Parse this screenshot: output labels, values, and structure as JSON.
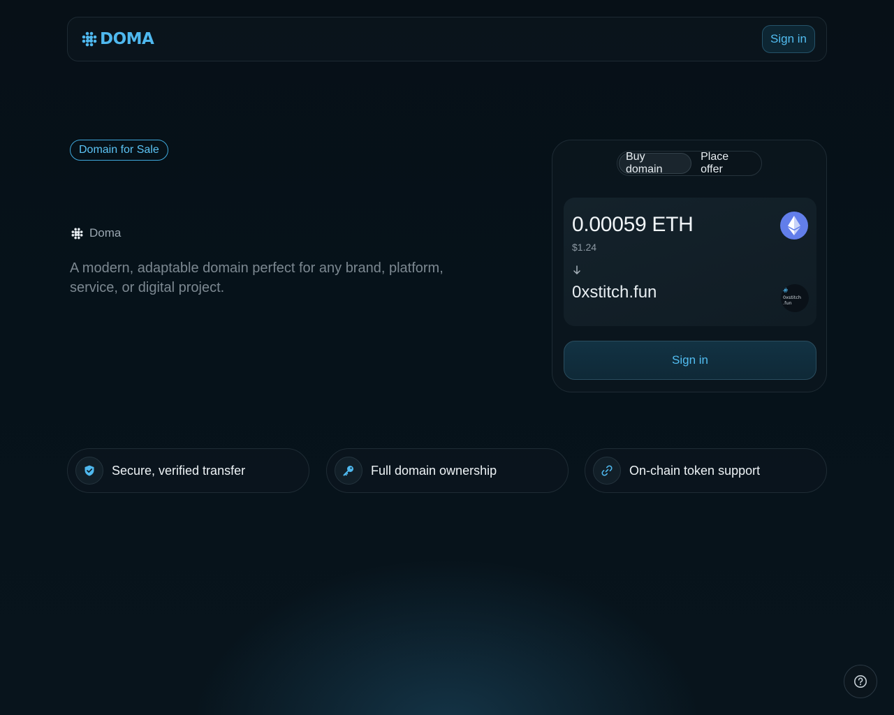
{
  "header": {
    "logo_text": "DOMA",
    "sign_in_label": "Sign in"
  },
  "hero": {
    "badge": "Domain for Sale",
    "brand_name": "Doma",
    "description": "A modern, adaptable domain perfect for any brand, platform, service, or digital project."
  },
  "card": {
    "tabs": [
      {
        "label": "Buy domain",
        "active": true
      },
      {
        "label": "Place offer",
        "active": false
      }
    ],
    "price": "0.00059 ETH",
    "fiat_price": "$1.24",
    "domain": "0xstitch.fun",
    "thumb_text": [
      "0xstitch",
      ".fun"
    ],
    "button_label": "Sign in",
    "currency_icon": "ethereum-icon"
  },
  "features": [
    {
      "label": "Secure, verified transfer",
      "icon": "shield-check-icon"
    },
    {
      "label": "Full domain ownership",
      "icon": "key-icon"
    },
    {
      "label": "On-chain token support",
      "icon": "link-icon"
    }
  ],
  "colors": {
    "accent": "#4fb8ee",
    "background": "#071017",
    "eth": "#627eea"
  }
}
